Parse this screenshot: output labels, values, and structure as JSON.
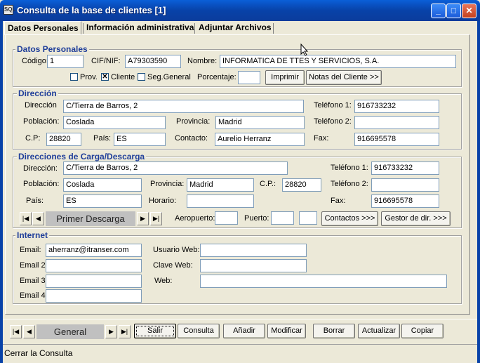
{
  "window": {
    "title": "Consulta de la base de clientes [1]",
    "icon_label": "SQL"
  },
  "tabs": [
    {
      "label": "Datos Personales"
    },
    {
      "label": "Información administrativa"
    },
    {
      "label": "Adjuntar Archivos"
    }
  ],
  "personal": {
    "title": "Datos Personales",
    "codigo_label": "Código:",
    "codigo": "1",
    "cif_label": "CIF/NIF:",
    "cif": "A79303590",
    "nombre_label": "Nombre:",
    "nombre": "INFORMATICA DE TTES Y SERVICIOS, S.A.",
    "prov_label": "Prov.",
    "prov_checked": false,
    "cliente_label": "Cliente",
    "cliente_checked": true,
    "seg_label": "Seg.General",
    "seg_checked": false,
    "porcentaje_label": "Porcentaje:",
    "porcentaje": "",
    "imprimir": "Imprimir",
    "notas": "Notas del Cliente >>"
  },
  "direccion": {
    "title": "Dirección",
    "direccion_label": "Dirección",
    "direccion": "C/Tierra de Barros, 2",
    "poblacion_label": "Población:",
    "poblacion": "Coslada",
    "provincia_label": "Provincia:",
    "provincia": "Madrid",
    "cp_label": "C.P:",
    "cp": "28820",
    "pais_label": "País:",
    "pais": "ES",
    "contacto_label": "Contacto:",
    "contacto": "Aurelio Herranz",
    "tel1_label": "Teléfono 1:",
    "tel1": "916733232",
    "tel2_label": "Teléfono 2:",
    "tel2": "",
    "fax_label": "Fax:",
    "fax": "916695578"
  },
  "carga": {
    "title": "Direcciones de Carga/Descarga",
    "direccion_label": "Dirección:",
    "direccion": "C/Tierra de Barros, 2",
    "poblacion_label": "Población:",
    "poblacion": "Coslada",
    "provincia_label": "Provincia:",
    "provincia": "Madrid",
    "cp_label": "C.P.:",
    "cp": "28820",
    "pais_label": "País:",
    "pais": "ES",
    "horario_label": "Horario:",
    "horario": "",
    "tel1_label": "Teléfono 1:",
    "tel1": "916733232",
    "tel2_label": "Teléfono 2:",
    "tel2": "",
    "fax_label": "Fax:",
    "fax": "916695578",
    "nav_label": "Primer Descarga",
    "aeropuerto_label": "Aeropuerto:",
    "aeropuerto": "",
    "puerto_label": "Puerto:",
    "puerto": "",
    "puerto2": "",
    "contactos": "Contactos >>>",
    "gestor": "Gestor de dir. >>>"
  },
  "internet": {
    "title": "Internet",
    "email_label": "Email:",
    "email": "aherranz@itranser.com",
    "email2_label": "Email 2:",
    "email2": "",
    "email3_label": "Email 3:",
    "email3": "",
    "email4_label": "Email 4:",
    "email4": "",
    "usuario_label": "Usuario Web:",
    "usuario": "",
    "clave_label": "Clave Web:",
    "clave": "",
    "web_label": "Web:",
    "web": ""
  },
  "bottom": {
    "nav_label": "General",
    "salir": "Salir",
    "consulta": "Consulta",
    "anadir": "Añadir",
    "modificar": "Modificar",
    "borrar": "Borrar",
    "actualizar": "Actualizar",
    "copiar": "Copiar"
  },
  "status": "Cerrar la Consulta"
}
